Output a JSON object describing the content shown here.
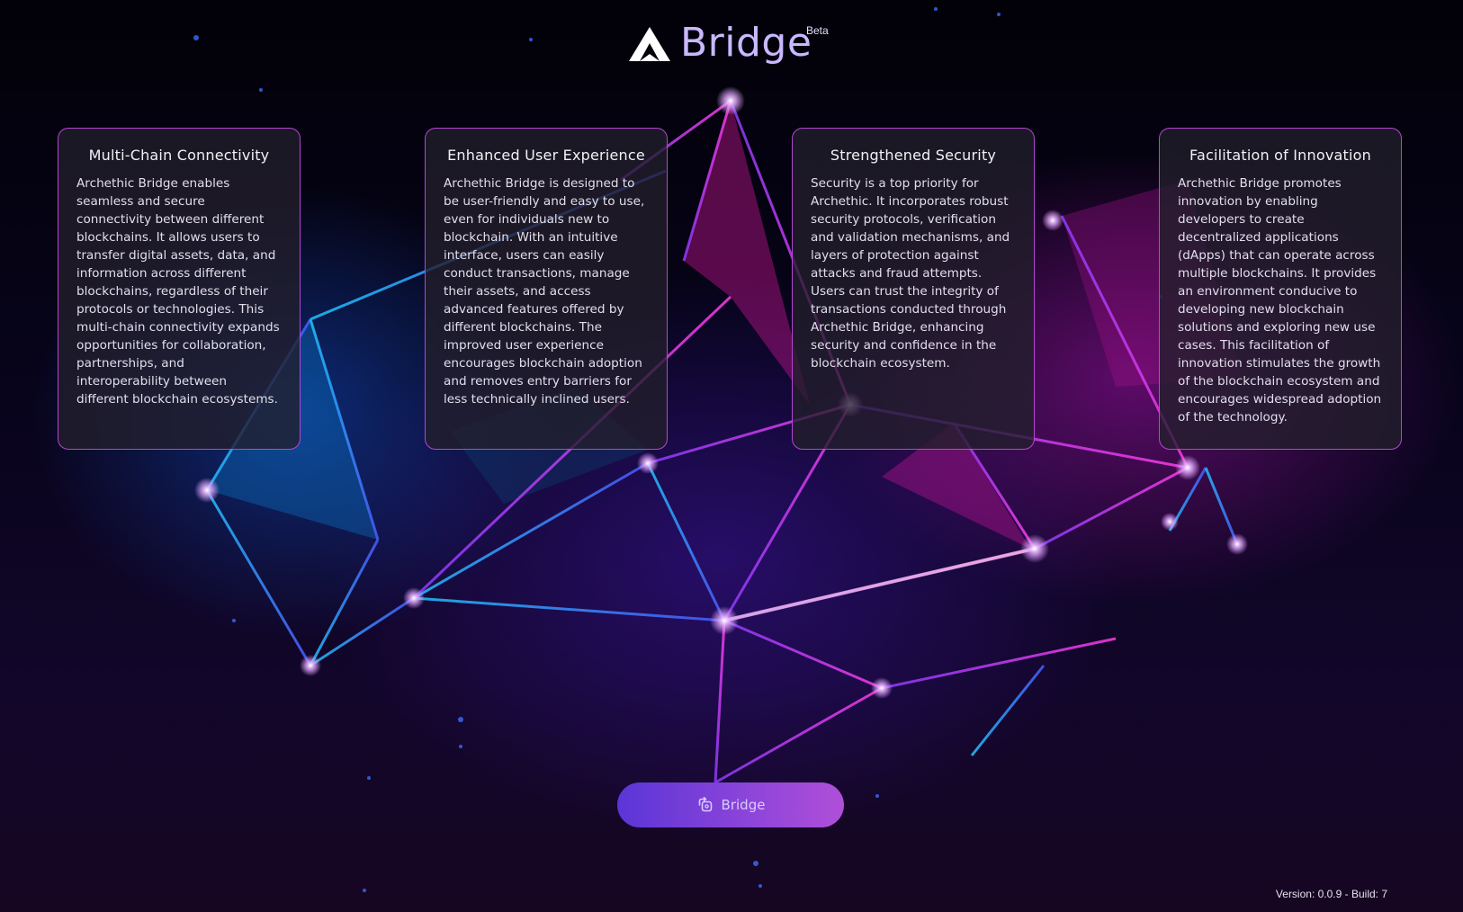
{
  "header": {
    "title": "Bridge",
    "badge": "Beta",
    "logo_icon": "archethic-triangle-logo-icon"
  },
  "cards": [
    {
      "title": "Multi-Chain Connectivity",
      "body": "Archethic Bridge enables seamless and secure connectivity between different blockchains. It allows users to transfer digital assets, data, and information across different blockchains, regardless of their protocols or technologies. This multi-chain connectivity expands opportunities for collaboration, partnerships, and interoperability between different blockchain ecosystems."
    },
    {
      "title": "Enhanced User Experience",
      "body": "Archethic Bridge is designed to be user-friendly and easy to use, even for individuals new to blockchain. With an intuitive interface, users can easily conduct transactions, manage their assets, and access advanced features offered by different blockchains. The improved user experience encourages blockchain adoption and removes entry barriers for less technically inclined users."
    },
    {
      "title": "Strengthened Security",
      "body": "Security is a top priority for Archethic. It incorporates robust security protocols, verification and validation mechanisms, and layers of protection against attacks and fraud attempts. Users can trust the integrity of transactions conducted through Archethic Bridge, enhancing security and confidence in the blockchain ecosystem."
    },
    {
      "title": "Facilitation of Innovation",
      "body": "Archethic Bridge promotes innovation by enabling developers to create decentralized applications (dApps) that can operate across multiple blockchains. It provides an environment conducive to developing new blockchain solutions and exploring new use cases. This facilitation of innovation stimulates the growth of the blockchain ecosystem and encourages widespread adoption of the technology."
    }
  ],
  "action": {
    "label": "Bridge",
    "icon": "swap-chains-icon"
  },
  "footer": {
    "version": "Version: 0.0.9 - Build: 7"
  },
  "colors": {
    "card_border": "#c44ae6",
    "button_start": "#5b35d8",
    "button_end": "#b04fd8",
    "title": "#c9b8ff"
  }
}
